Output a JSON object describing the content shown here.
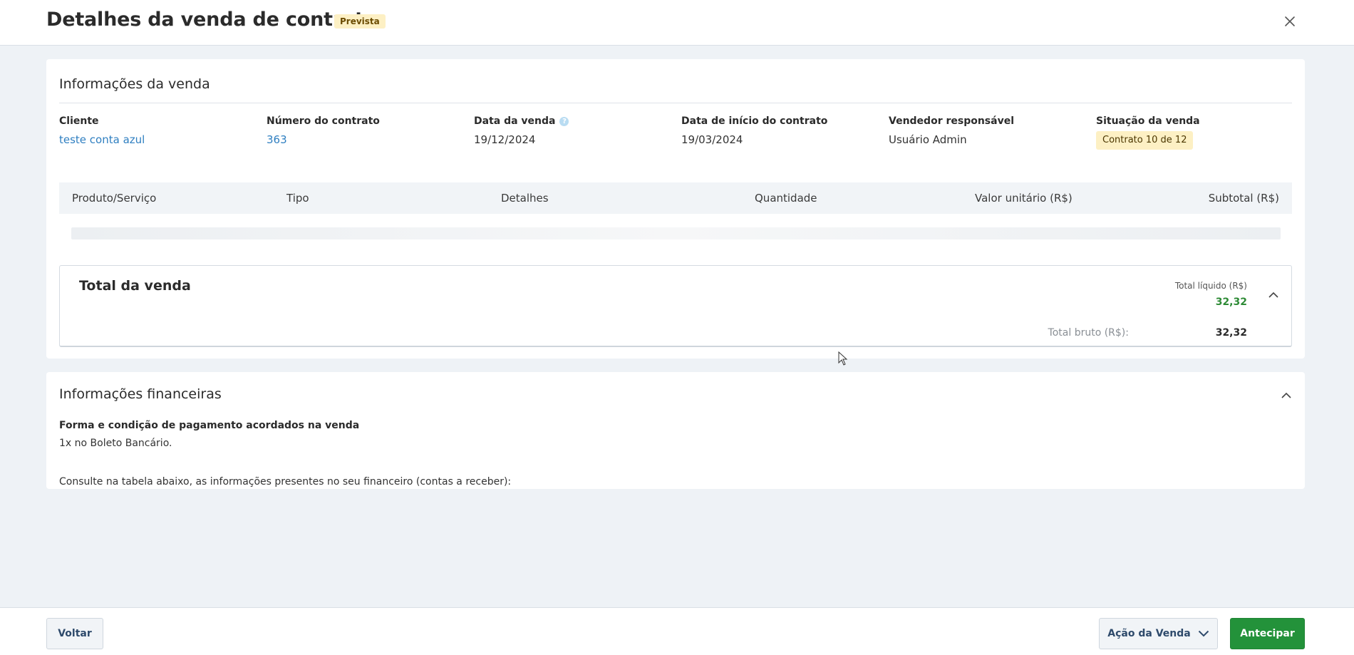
{
  "header": {
    "title": "Detalhes da venda de contrato",
    "badge": "Prevista"
  },
  "sale_info": {
    "title": "Informações da venda",
    "fields": {
      "cliente": {
        "label": "Cliente",
        "value": "teste conta azul"
      },
      "contrato": {
        "label": "Número do contrato",
        "value": "363"
      },
      "data_venda": {
        "label": "Data da venda",
        "value": "19/12/2024"
      },
      "data_inicio": {
        "label": "Data de início do contrato",
        "value": "19/03/2024"
      },
      "vendedor": {
        "label": "Vendedor responsável",
        "value": "Usuário Admin"
      },
      "situacao": {
        "label": "Situação da venda",
        "value": "Contrato 10 de 12"
      }
    },
    "help_glyph": "?"
  },
  "items_table": {
    "columns": [
      "Produto/Serviço",
      "Tipo",
      "Detalhes",
      "Quantidade",
      "Valor unitário (R$)",
      "Subtotal (R$)"
    ]
  },
  "totals": {
    "title": "Total da venda",
    "net_label": "Total líquido (R$)",
    "net_value": "32,32",
    "gross_label": "Total bruto (R$):",
    "gross_value": "32,32"
  },
  "financial": {
    "title": "Informações financeiras",
    "payment_heading": "Forma e condição de pagamento acordados na venda",
    "payment_text": "1x no Boleto Bancário.",
    "table_hint": "Consulte na tabela abaixo, as informações presentes no seu financeiro (contas a receber):"
  },
  "footer": {
    "back_label": "Voltar",
    "action_label": "Ação da Venda",
    "advance_label": "Antecipar"
  },
  "colors": {
    "accent_green": "#23923a",
    "link_blue": "#2f7fc1",
    "badge_yellow": "#fdf0c4"
  },
  "icons": {
    "close": "close-icon",
    "help": "help-icon",
    "collapse": "chevron-up-icon",
    "dropdown": "chevron-down-icon"
  }
}
